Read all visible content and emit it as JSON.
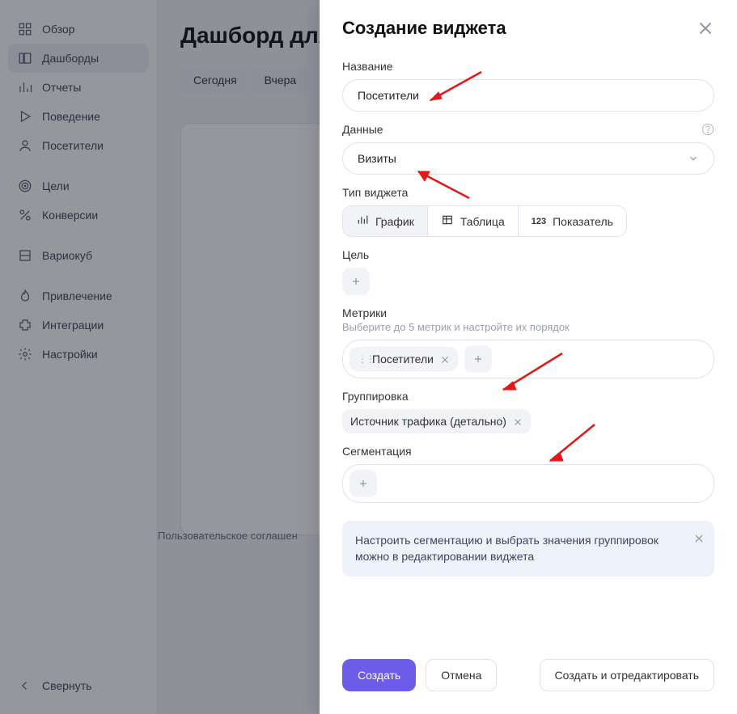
{
  "sidebar": {
    "items": [
      {
        "label": "Обзор"
      },
      {
        "label": "Дашборды"
      },
      {
        "label": "Отчеты"
      },
      {
        "label": "Поведение"
      },
      {
        "label": "Посетители"
      },
      {
        "label": "Цели"
      },
      {
        "label": "Конверсии"
      },
      {
        "label": "Вариокуб"
      },
      {
        "label": "Привлечение"
      },
      {
        "label": "Интеграции"
      },
      {
        "label": "Настройки"
      }
    ],
    "collapse": "Свернуть"
  },
  "main": {
    "title": "Дашборд для",
    "date_tabs": [
      "Сегодня",
      "Вчера"
    ],
    "footer": "Пользовательское соглашен"
  },
  "modal": {
    "title": "Создание виджета",
    "labels": {
      "name": "Название",
      "data": "Данные",
      "widget_type": "Тип виджета",
      "goal": "Цель",
      "metrics": "Метрики",
      "grouping": "Группировка",
      "segmentation": "Сегментация"
    },
    "name_value": "Посетители",
    "data_value": "Визиты",
    "widget_types": [
      {
        "label": "График"
      },
      {
        "label": "Таблица"
      },
      {
        "label": "Показатель"
      }
    ],
    "metrics_hint": "Выберите до 5 метрик и настройте их порядок",
    "metric_chip": "Посетители",
    "grouping_chip": "Источник трафика (детально)",
    "info": "Настроить сегментацию и выбрать значения группировок можно в редактировании виджета",
    "buttons": {
      "create": "Создать",
      "cancel": "Отмена",
      "create_edit": "Создать и отредактировать"
    }
  }
}
